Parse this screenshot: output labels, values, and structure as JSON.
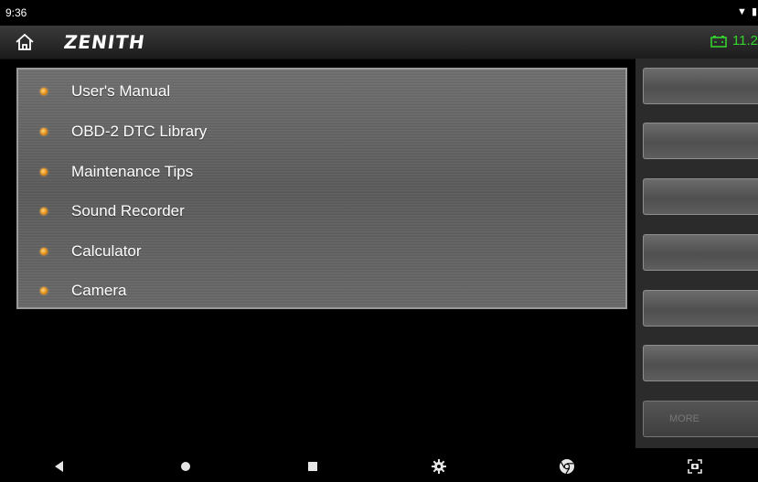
{
  "status_bar": {
    "time": "9:36",
    "icons": "▼ ▮"
  },
  "app_bar": {
    "logo_text": "ZENITH",
    "battery_voltage": "11.2"
  },
  "menu": {
    "items": [
      {
        "label": "User's Manual"
      },
      {
        "label": "OBD-2 DTC Library"
      },
      {
        "label": "Maintenance Tips"
      },
      {
        "label": "Sound Recorder"
      },
      {
        "label": "Calculator"
      },
      {
        "label": "Camera"
      }
    ]
  },
  "right_rail": {
    "more_label": "MORE"
  },
  "nav_bar": {
    "buttons": [
      "back-icon",
      "home-circle-icon",
      "recents-icon",
      "settings-gear-icon",
      "browser-icon",
      "screenshot-icon"
    ]
  },
  "colors": {
    "battery": "#34d32e",
    "menu_dot": "#e08a12"
  }
}
